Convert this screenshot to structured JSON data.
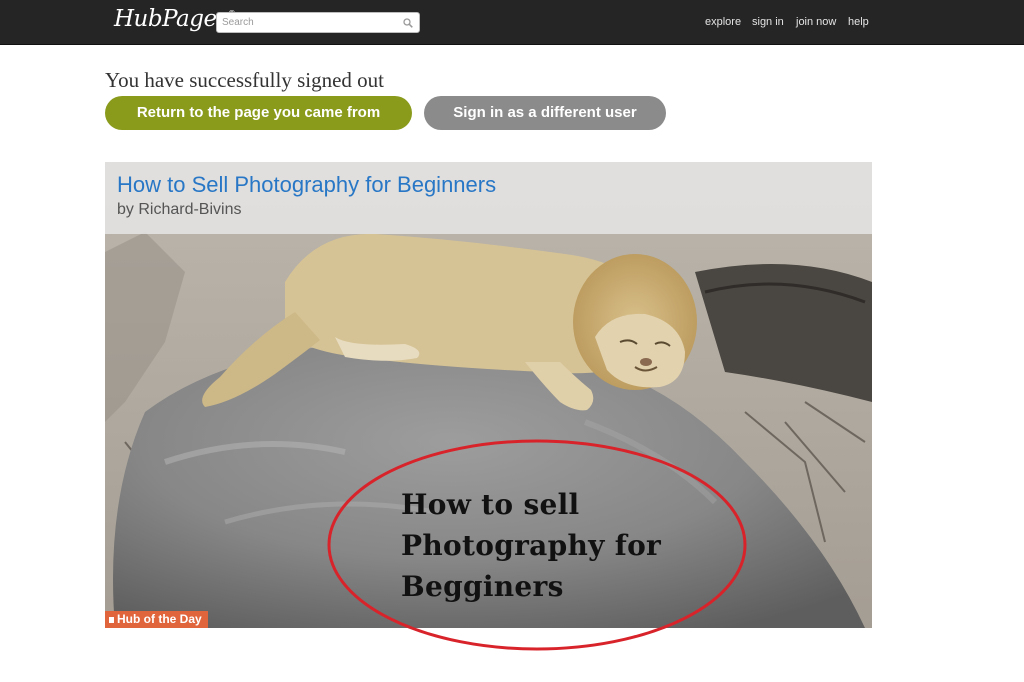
{
  "header": {
    "logo_text": "HubPages",
    "logo_mark": "®",
    "search_placeholder": "Search",
    "nav": {
      "explore": "explore",
      "sign_in": "sign in",
      "join_now": "join now",
      "help": "help"
    }
  },
  "signout": {
    "message": "You have successfully signed out",
    "return_button": "Return to the page you came from",
    "switch_user_button": "Sign in as a different user"
  },
  "featured_hub": {
    "title": "How to Sell Photography for Beginners",
    "author": "by Richard-Bivins",
    "photo_caption_lines": [
      "How to sell",
      "Photography for",
      "Begginers"
    ],
    "badge": "Hub of the Day"
  },
  "colors": {
    "topbar": "#252525",
    "return_button": "#8a9b1c",
    "switch_button": "#8b8b8b",
    "hub_link": "#2877c6",
    "badge": "#e0653c",
    "annotation": "#d8232a"
  }
}
